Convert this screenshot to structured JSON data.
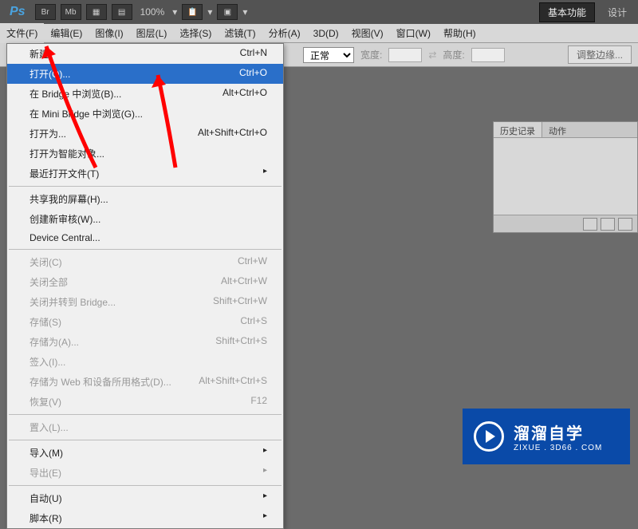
{
  "app": {
    "logo": "Ps",
    "zoom": "100%"
  },
  "topbar_buttons": [
    "Br",
    "Mb"
  ],
  "workspace": {
    "basic": "基本功能",
    "design": "设计"
  },
  "menubar": [
    "文件(F)",
    "编辑(E)",
    "图像(I)",
    "图层(L)",
    "选择(S)",
    "滤镜(T)",
    "分析(A)",
    "3D(D)",
    "视图(V)",
    "窗口(W)",
    "帮助(H)"
  ],
  "options_bar": {
    "mode_value": "正常",
    "width_label": "宽度:",
    "height_label": "高度:",
    "adjust_edges": "调整边缘..."
  },
  "file_menu": {
    "groups": [
      [
        {
          "label": "新建",
          "shortcut": "Ctrl+N",
          "enabled": true
        },
        {
          "label": "打开(O)...",
          "shortcut": "Ctrl+O",
          "enabled": true,
          "highlighted": true
        },
        {
          "label": "在 Bridge 中浏览(B)...",
          "shortcut": "Alt+Ctrl+O",
          "enabled": true
        },
        {
          "label": "在 Mini Bridge 中浏览(G)...",
          "shortcut": "",
          "enabled": true
        },
        {
          "label": "打开为...",
          "shortcut": "Alt+Shift+Ctrl+O",
          "enabled": true
        },
        {
          "label": "打开为智能对象...",
          "shortcut": "",
          "enabled": true
        },
        {
          "label": "最近打开文件(T)",
          "shortcut": "",
          "enabled": true,
          "submenu": true
        }
      ],
      [
        {
          "label": "共享我的屏幕(H)...",
          "shortcut": "",
          "enabled": true
        },
        {
          "label": "创建新审核(W)...",
          "shortcut": "",
          "enabled": true
        },
        {
          "label": "Device Central...",
          "shortcut": "",
          "enabled": true
        }
      ],
      [
        {
          "label": "关闭(C)",
          "shortcut": "Ctrl+W",
          "enabled": false
        },
        {
          "label": "关闭全部",
          "shortcut": "Alt+Ctrl+W",
          "enabled": false
        },
        {
          "label": "关闭并转到 Bridge...",
          "shortcut": "Shift+Ctrl+W",
          "enabled": false
        },
        {
          "label": "存储(S)",
          "shortcut": "Ctrl+S",
          "enabled": false
        },
        {
          "label": "存储为(A)...",
          "shortcut": "Shift+Ctrl+S",
          "enabled": false
        },
        {
          "label": "签入(I)...",
          "shortcut": "",
          "enabled": false
        },
        {
          "label": "存储为 Web 和设备所用格式(D)...",
          "shortcut": "Alt+Shift+Ctrl+S",
          "enabled": false
        },
        {
          "label": "恢复(V)",
          "shortcut": "F12",
          "enabled": false
        }
      ],
      [
        {
          "label": "置入(L)...",
          "shortcut": "",
          "enabled": false
        }
      ],
      [
        {
          "label": "导入(M)",
          "shortcut": "",
          "enabled": true,
          "submenu": true
        },
        {
          "label": "导出(E)",
          "shortcut": "",
          "enabled": false,
          "submenu": true
        }
      ],
      [
        {
          "label": "自动(U)",
          "shortcut": "",
          "enabled": true,
          "submenu": true
        },
        {
          "label": "脚本(R)",
          "shortcut": "",
          "enabled": true,
          "submenu": true
        }
      ]
    ]
  },
  "history_panel": {
    "tabs": [
      "历史记录",
      "动作"
    ]
  },
  "watermark": {
    "main": "溜溜自学",
    "sub": "ZIXUE . 3D66 . COM"
  }
}
